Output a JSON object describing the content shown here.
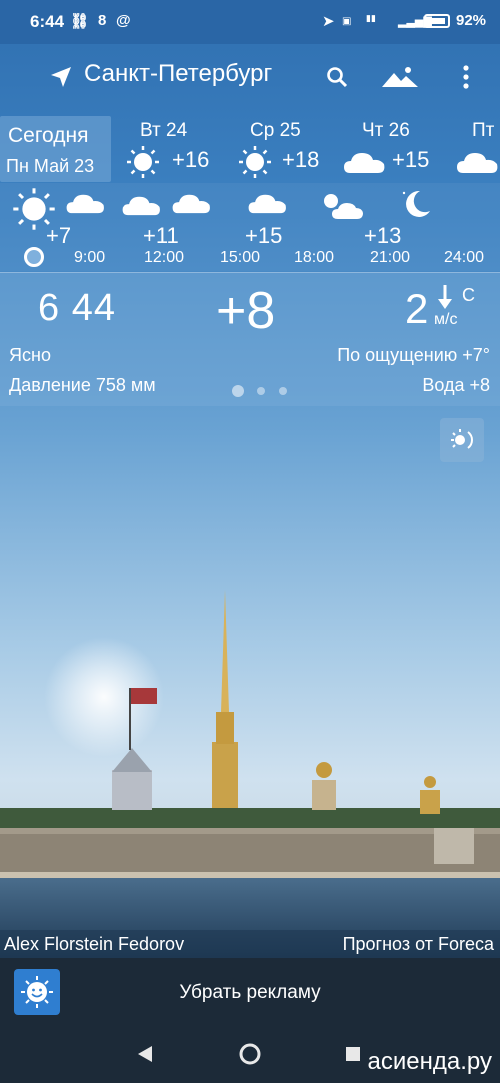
{
  "status_bar": {
    "time": "6:44",
    "temp_indicator": "8",
    "battery_percent": "92%"
  },
  "header": {
    "city": "Санкт-Петербург",
    "icons": [
      "location-arrow-icon",
      "search-icon",
      "mountain-icon",
      "more-vert-icon"
    ]
  },
  "days": {
    "today_label": "Сегодня",
    "today_date": "Пн Май 23",
    "items": [
      {
        "label": "Вт 24",
        "temp": "+16",
        "icon": "sun-icon"
      },
      {
        "label": "Ср 25",
        "temp": "+18",
        "icon": "sun-icon"
      },
      {
        "label": "Чт 26",
        "temp": "+15",
        "icon": "cloud-icon"
      },
      {
        "label": "Пт",
        "temp": "",
        "icon": "cloud-icon"
      }
    ]
  },
  "hourly": {
    "temps": [
      "+7",
      "+11",
      "+15",
      "+13"
    ],
    "times": [
      "9:00",
      "12:00",
      "15:00",
      "18:00",
      "21:00",
      "24:00"
    ]
  },
  "current": {
    "time": "6 44",
    "temp": "+8",
    "wind_speed": "2",
    "wind_dir": "С",
    "wind_unit": "м/с",
    "condition": "Ясно",
    "feels_like": "По ощущению +7°",
    "pressure": "Давление 758 мм",
    "water": "Вода +8"
  },
  "credits": {
    "photo_author": "Alex Florstein Fedorov",
    "provider": "Прогноз от Foreca"
  },
  "ad": {
    "remove_ads": "Убрать рекламу"
  },
  "watermark": "асиенда.ру",
  "colors": {
    "status_bar": "#2a66a6",
    "sky_top": "#2f6fb0",
    "ad_bar": "#1c2a38"
  }
}
